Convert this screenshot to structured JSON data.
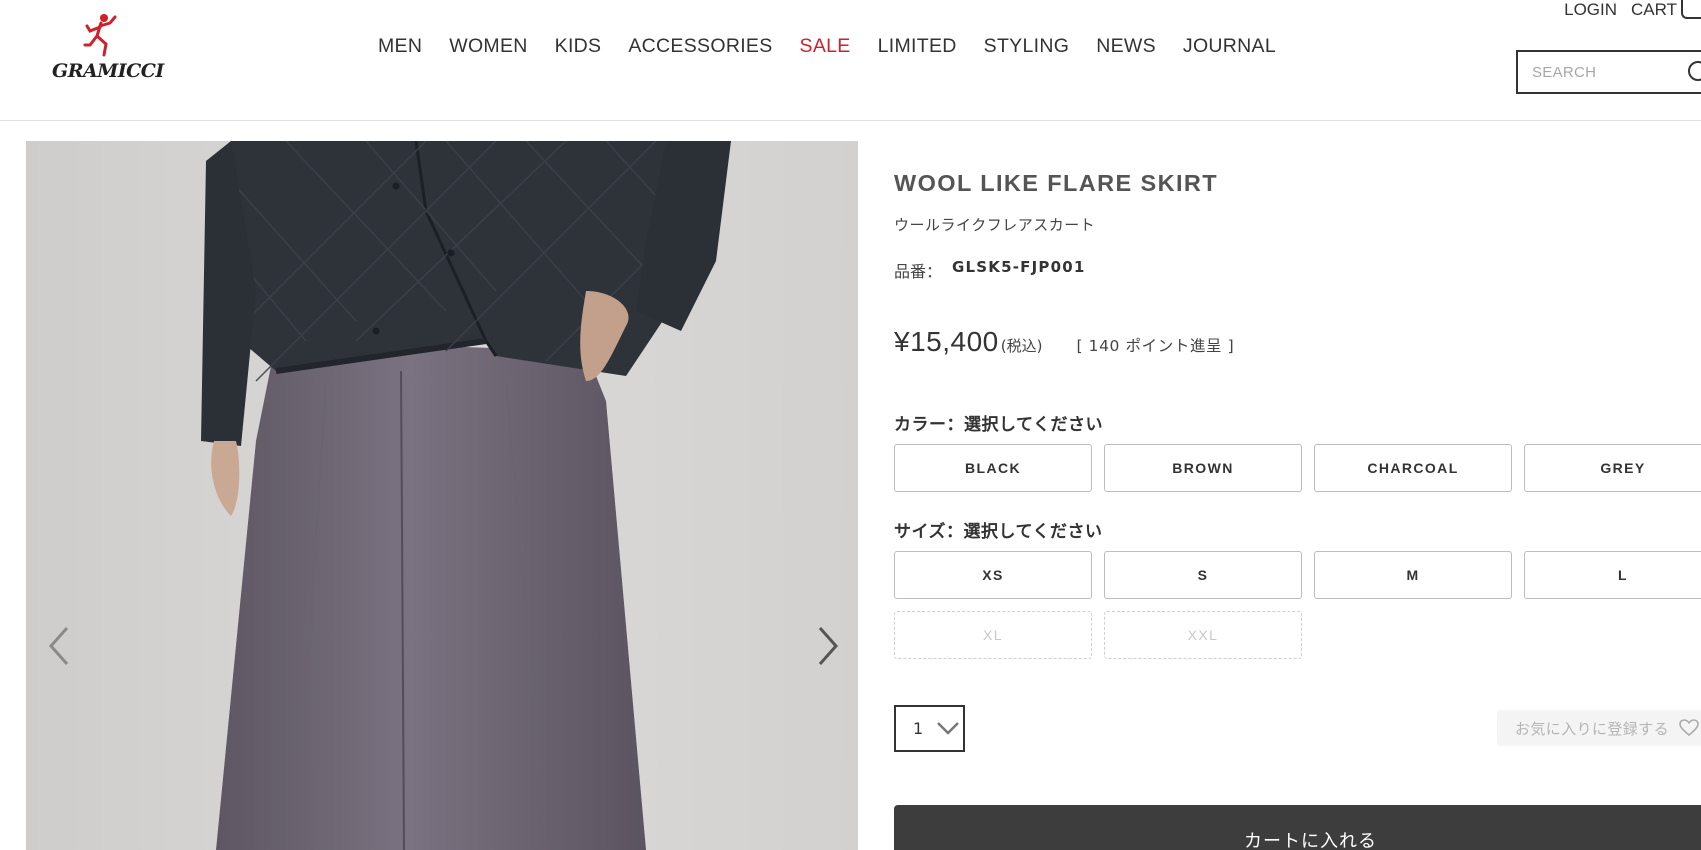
{
  "brand": {
    "logo_text": "GRAMICCI"
  },
  "nav": {
    "items": [
      {
        "label": "MEN",
        "name": "nav-men"
      },
      {
        "label": "WOMEN",
        "name": "nav-women"
      },
      {
        "label": "KIDS",
        "name": "nav-kids"
      },
      {
        "label": "ACCESSORIES",
        "name": "nav-accessories"
      },
      {
        "label": "SALE",
        "name": "nav-sale"
      },
      {
        "label": "LIMITED",
        "name": "nav-limited"
      },
      {
        "label": "STYLING",
        "name": "nav-styling"
      },
      {
        "label": "NEWS",
        "name": "nav-news"
      },
      {
        "label": "JOURNAL",
        "name": "nav-journal"
      }
    ],
    "sale_color": "#d0202d"
  },
  "utility": {
    "login": "LOGIN",
    "cart": "CART"
  },
  "search": {
    "placeholder": "SEARCH"
  },
  "product": {
    "title": "WOOL LIKE FLARE SKIRT",
    "subtitle": "ウールライクフレアスカート",
    "sku_label": "品番：",
    "sku": "GLSK5-FJP001",
    "price": "¥15,400",
    "tax_note": "(税込)",
    "points": "[ 140 ポイント進呈 ]",
    "color_label": "カラー：選択してください",
    "colors": [
      "BLACK",
      "BROWN",
      "CHARCOAL",
      "GREY"
    ],
    "size_label": "サイズ：選択してください",
    "sizes": [
      {
        "label": "XS",
        "available": true
      },
      {
        "label": "S",
        "available": true
      },
      {
        "label": "M",
        "available": true
      },
      {
        "label": "L",
        "available": true
      },
      {
        "label": "XL",
        "available": false
      },
      {
        "label": "XXL",
        "available": false
      }
    ],
    "quantity": "1",
    "favorite_label": "お気に入りに登録する",
    "add_to_cart_label": "カートに入れる"
  },
  "icons": {
    "logo": "gramicci-running-man-icon",
    "cart": "cart-icon",
    "search": "search-icon",
    "prev": "chevron-left-icon",
    "next": "chevron-right-icon",
    "qty": "chevron-down-icon",
    "favorite": "heart-icon"
  }
}
